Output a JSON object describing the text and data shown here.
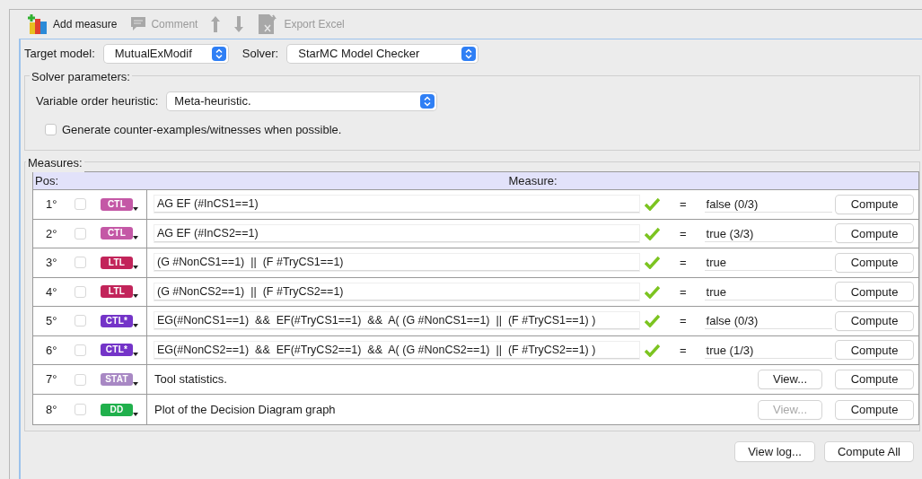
{
  "toolbar": [
    {
      "kind": "add",
      "label": "Add measure",
      "disabled": false
    },
    {
      "kind": "comment",
      "label": "Comment",
      "disabled": true
    },
    {
      "kind": "up",
      "disabled": true
    },
    {
      "kind": "down",
      "disabled": true
    },
    {
      "kind": "excel",
      "label": "Export Excel",
      "disabled": true
    }
  ],
  "target_model": {
    "label": "Target model:",
    "value": "MutualExModif"
  },
  "solver": {
    "label": "Solver:",
    "value": "StarMC Model Checker"
  },
  "solver_parameters": {
    "title": "Solver parameters:",
    "heuristic_label": "Variable order heuristic:",
    "heuristic_value": "Meta-heuristic.",
    "counterexamples": {
      "label": "Generate counter-examples/witnesses when possible.",
      "checked": false
    }
  },
  "measures": {
    "title": "Measures:",
    "columns": [
      "Pos:",
      "Measure:"
    ],
    "rows": [
      {
        "pos": "1°",
        "checked": false,
        "tag": "CTL",
        "color": "#c458a6",
        "kind": "formula",
        "formula": "AG EF (#InCS1==1)",
        "valid": true,
        "equals": "=",
        "result": "false (0/3)",
        "compute": "Compute"
      },
      {
        "pos": "2°",
        "checked": false,
        "tag": "CTL",
        "color": "#c458a6",
        "kind": "formula",
        "formula": "AG EF (#InCS2==1)",
        "valid": true,
        "equals": "=",
        "result": "true (3/3)",
        "compute": "Compute"
      },
      {
        "pos": "3°",
        "checked": false,
        "tag": "LTL",
        "color": "#c2245a",
        "kind": "formula",
        "formula": "(G #NonCS1==1)  ||  (F #TryCS1==1)",
        "valid": true,
        "equals": "=",
        "result": "true",
        "compute": "Compute"
      },
      {
        "pos": "4°",
        "checked": false,
        "tag": "LTL",
        "color": "#c2245a",
        "kind": "formula",
        "formula": "(G #NonCS2==1)  ||  (F #TryCS2==1)",
        "valid": true,
        "equals": "=",
        "result": "true",
        "compute": "Compute"
      },
      {
        "pos": "5°",
        "checked": false,
        "tag": "CTL*",
        "color": "#7434c8",
        "kind": "formula",
        "formula": "EG(#NonCS1==1)  &&  EF(#TryCS1==1)  &&  A( (G #NonCS1==1)  ||  (F #TryCS1==1) )",
        "valid": true,
        "equals": "=",
        "result": "false (0/3)",
        "compute": "Compute"
      },
      {
        "pos": "6°",
        "checked": false,
        "tag": "CTL*",
        "color": "#7434c8",
        "kind": "formula",
        "formula": "EG(#NonCS2==1)  &&  EF(#TryCS2==1)  &&  A( (G #NonCS2==1)  ||  (F #TryCS2==1) )",
        "valid": true,
        "equals": "=",
        "result": "true (1/3)",
        "compute": "Compute"
      },
      {
        "pos": "7°",
        "checked": false,
        "tag": "STAT",
        "color": "#a888c4",
        "kind": "view",
        "text": "Tool statistics.",
        "view": {
          "label": "View...",
          "disabled": false
        },
        "compute": "Compute"
      },
      {
        "pos": "8°",
        "checked": false,
        "tag": "DD",
        "color": "#20b04c",
        "kind": "view",
        "text": "Plot of the Decision Diagram graph",
        "view": {
          "label": "View...",
          "disabled": true
        },
        "compute": "Compute"
      }
    ]
  },
  "buttons": [
    "View log...",
    "Compute All"
  ]
}
